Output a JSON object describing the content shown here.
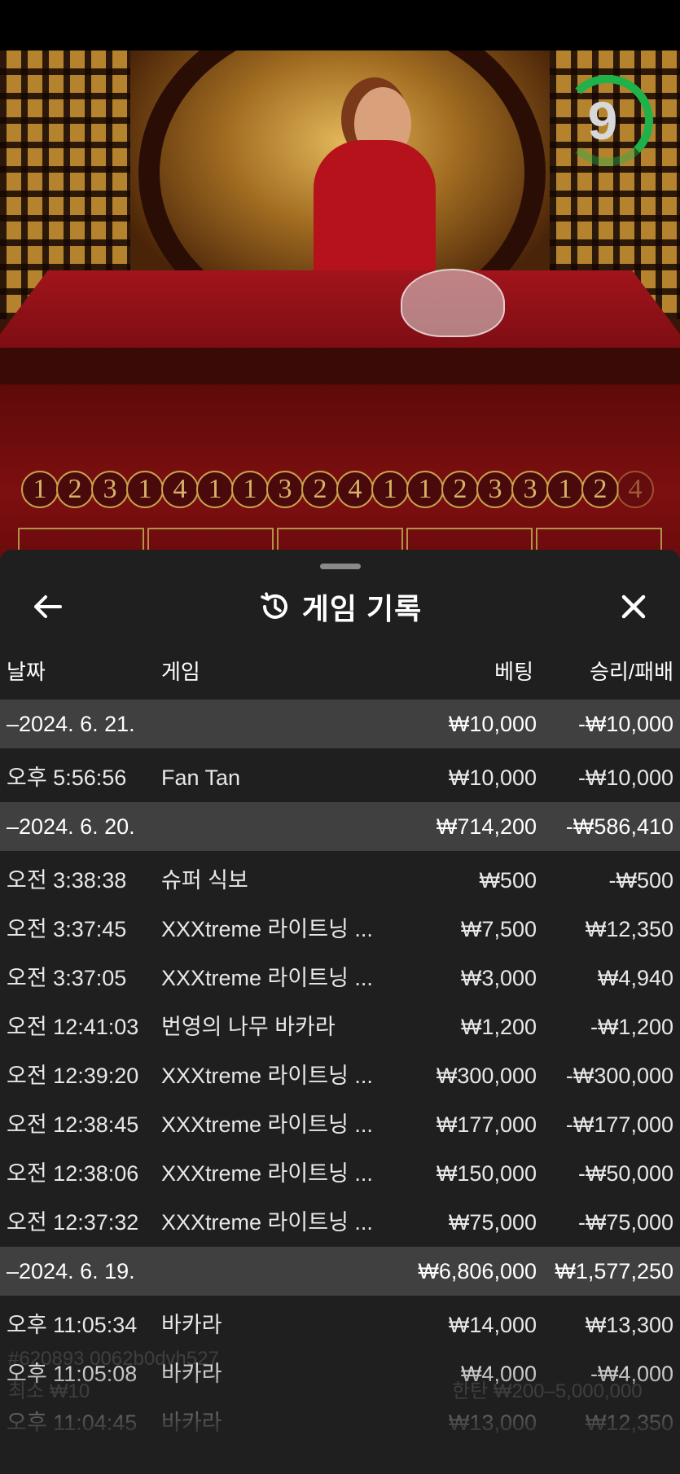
{
  "timer": {
    "value": "9"
  },
  "road": {
    "numbers": [
      "1",
      "2",
      "3",
      "1",
      "4",
      "1",
      "1",
      "3",
      "2",
      "4",
      "1",
      "1",
      "2",
      "3",
      "3",
      "1",
      "2",
      "4"
    ]
  },
  "sheet": {
    "title": "게임 기록",
    "icons": {
      "back": "arrow-left-icon",
      "history": "history-icon",
      "close": "close-icon"
    },
    "columns": {
      "date": "날짜",
      "game": "게임",
      "bet": "베팅",
      "result": "승리/패배"
    },
    "rows": [
      {
        "type": "group",
        "date": "–2024. 6. 21.",
        "bet": "₩10,000",
        "result": "-₩10,000"
      },
      {
        "type": "item",
        "time": "오후 5:56:56",
        "game": "Fan Tan",
        "bet": "₩10,000",
        "result": "-₩10,000"
      },
      {
        "type": "group",
        "date": "–2024. 6. 20.",
        "bet": "₩714,200",
        "result": "-₩586,410"
      },
      {
        "type": "item",
        "time": "오전 3:38:38",
        "game": "슈퍼 식보",
        "bet": "₩500",
        "result": "-₩500"
      },
      {
        "type": "item",
        "time": "오전 3:37:45",
        "game": "XXXtreme 라이트닝 ...",
        "bet": "₩7,500",
        "result": "₩12,350"
      },
      {
        "type": "item",
        "time": "오전 3:37:05",
        "game": "XXXtreme 라이트닝 ...",
        "bet": "₩3,000",
        "result": "₩4,940"
      },
      {
        "type": "item",
        "time": "오전 12:41:03",
        "game": "번영의 나무 바카라",
        "bet": "₩1,200",
        "result": "-₩1,200"
      },
      {
        "type": "item",
        "time": "오전 12:39:20",
        "game": "XXXtreme 라이트닝 ...",
        "bet": "₩300,000",
        "result": "-₩300,000"
      },
      {
        "type": "item",
        "time": "오전 12:38:45",
        "game": "XXXtreme 라이트닝 ...",
        "bet": "₩177,000",
        "result": "-₩177,000"
      },
      {
        "type": "item",
        "time": "오전 12:38:06",
        "game": "XXXtreme 라이트닝 ...",
        "bet": "₩150,000",
        "result": "-₩50,000"
      },
      {
        "type": "item",
        "time": "오전 12:37:32",
        "game": "XXXtreme 라이트닝 ...",
        "bet": "₩75,000",
        "result": "-₩75,000"
      },
      {
        "type": "group",
        "date": "–2024. 6. 19.",
        "bet": "₩6,806,000",
        "result": "₩1,577,250"
      },
      {
        "type": "item",
        "time": "오후 11:05:34",
        "game": "바카라",
        "bet": "₩14,000",
        "result": "₩13,300"
      },
      {
        "type": "item",
        "time": "오후 11:05:08",
        "game": "바카라",
        "bet": "₩4,000",
        "result": "-₩4,000"
      },
      {
        "type": "item",
        "time": "오후 11:04:45",
        "game": "바카라",
        "bet": "₩13,000",
        "result": "₩12,350"
      }
    ]
  },
  "background_text": {
    "id": "#620893 0062b0dvh527",
    "min": "최소 ₩10",
    "limit": "한탄 ₩200–5,000,000"
  },
  "colors": {
    "sheet": "#1f1f1f",
    "group_row": "#404040",
    "timer": "#1fb14a",
    "gold": "#c9a24a"
  }
}
